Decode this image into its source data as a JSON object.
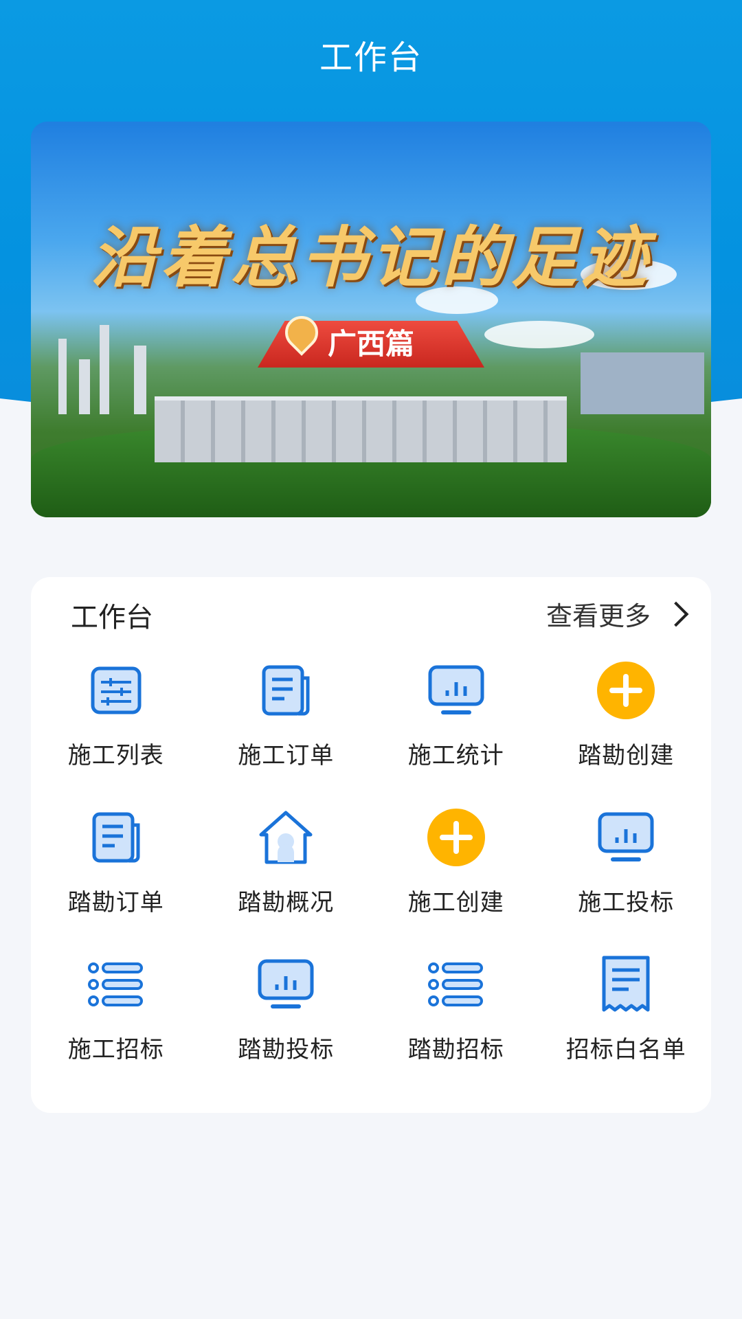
{
  "header": {
    "title": "工作台"
  },
  "banner": {
    "title": "沿着总书记的足迹",
    "subtitle": "广西篇"
  },
  "workbench": {
    "title": "工作台",
    "more_label": "查看更多",
    "items": [
      {
        "label": "施工列表",
        "icon": "sliders-list-icon"
      },
      {
        "label": "施工订单",
        "icon": "document-icon"
      },
      {
        "label": "施工统计",
        "icon": "monitor-chart-icon"
      },
      {
        "label": "踏勘创建",
        "icon": "plus-circle-icon"
      },
      {
        "label": "踏勘订单",
        "icon": "document-icon"
      },
      {
        "label": "踏勘概况",
        "icon": "home-icon"
      },
      {
        "label": "施工创建",
        "icon": "plus-circle-icon"
      },
      {
        "label": "施工投标",
        "icon": "monitor-chart-icon"
      },
      {
        "label": "施工招标",
        "icon": "bullet-list-icon"
      },
      {
        "label": "踏勘投标",
        "icon": "monitor-chart-icon"
      },
      {
        "label": "踏勘招标",
        "icon": "bullet-list-icon"
      },
      {
        "label": "招标白名单",
        "icon": "receipt-icon"
      }
    ]
  },
  "colors": {
    "header_blue": "#0b9ae3",
    "icon_blue": "#1a73d9",
    "icon_fill": "#cfe3fb",
    "accent_yellow": "#ffb400"
  }
}
